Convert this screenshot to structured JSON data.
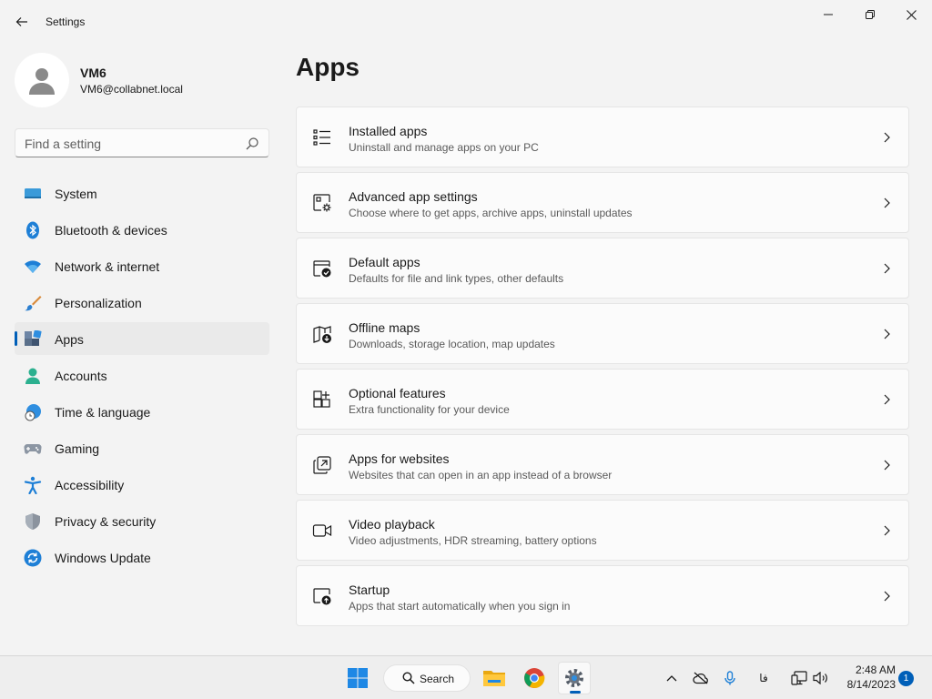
{
  "window": {
    "title": "Settings"
  },
  "profile": {
    "name": "VM6",
    "email": "VM6@collabnet.local"
  },
  "search": {
    "placeholder": "Find a setting"
  },
  "sidebar": {
    "items": [
      {
        "label": "System",
        "icon": "monitor-icon"
      },
      {
        "label": "Bluetooth & devices",
        "icon": "bluetooth-icon"
      },
      {
        "label": "Network & internet",
        "icon": "wifi-icon"
      },
      {
        "label": "Personalization",
        "icon": "brush-icon"
      },
      {
        "label": "Apps",
        "icon": "apps-icon",
        "selected": true
      },
      {
        "label": "Accounts",
        "icon": "person-icon"
      },
      {
        "label": "Time & language",
        "icon": "globe-clock-icon"
      },
      {
        "label": "Gaming",
        "icon": "gamepad-icon"
      },
      {
        "label": "Accessibility",
        "icon": "accessibility-icon"
      },
      {
        "label": "Privacy & security",
        "icon": "shield-icon"
      },
      {
        "label": "Windows Update",
        "icon": "update-icon"
      }
    ]
  },
  "main": {
    "title": "Apps",
    "cards": [
      {
        "title": "Installed apps",
        "subtitle": "Uninstall and manage apps on your PC",
        "icon": "list-icon"
      },
      {
        "title": "Advanced app settings",
        "subtitle": "Choose where to get apps, archive apps, uninstall updates",
        "icon": "app-gear-icon"
      },
      {
        "title": "Default apps",
        "subtitle": "Defaults for file and link types, other defaults",
        "icon": "default-check-icon"
      },
      {
        "title": "Offline maps",
        "subtitle": "Downloads, storage location, map updates",
        "icon": "map-download-icon"
      },
      {
        "title": "Optional features",
        "subtitle": "Extra functionality for your device",
        "icon": "add-grid-icon"
      },
      {
        "title": "Apps for websites",
        "subtitle": "Websites that can open in an app instead of a browser",
        "icon": "open-in-app-icon"
      },
      {
        "title": "Video playback",
        "subtitle": "Video adjustments, HDR streaming, battery options",
        "icon": "video-icon"
      },
      {
        "title": "Startup",
        "subtitle": "Apps that start automatically when you sign in",
        "icon": "startup-icon"
      }
    ]
  },
  "taskbar": {
    "search_label": "Search",
    "ime_indicator": "فا",
    "time": "2:48 AM",
    "date": "8/14/2023",
    "notification_count": "1"
  },
  "colors": {
    "accent": "#005fb8",
    "background": "#f3f3f3",
    "card": "#fbfbfb"
  }
}
